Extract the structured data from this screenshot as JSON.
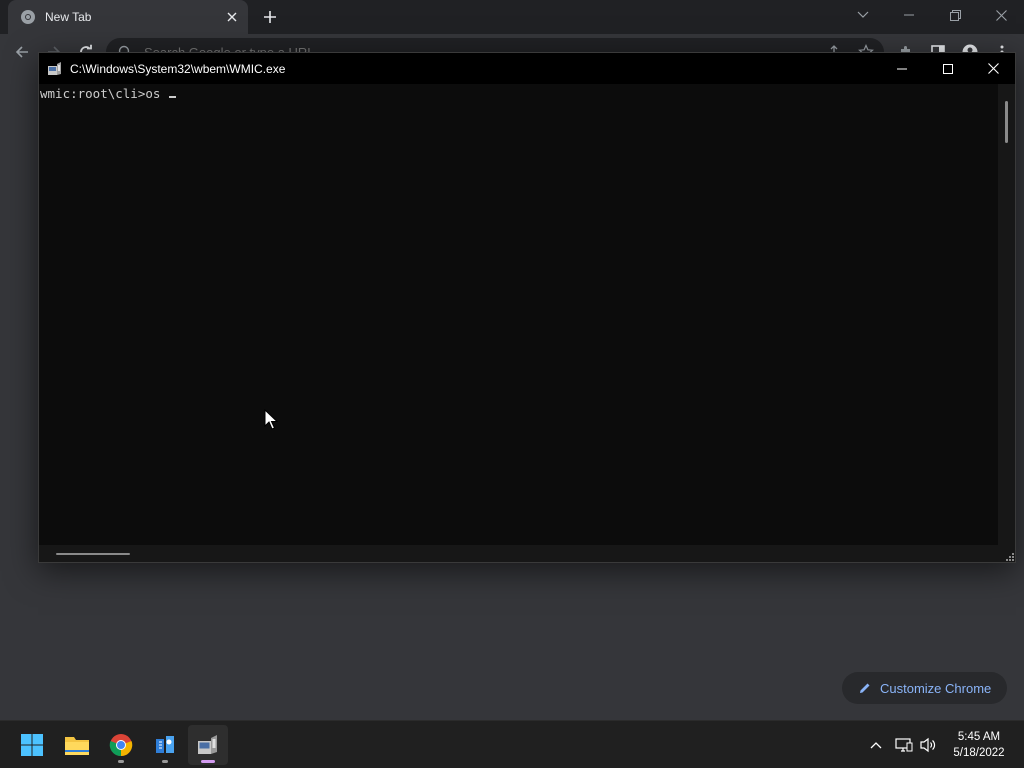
{
  "chrome": {
    "tab_title": "New Tab",
    "omnibox_placeholder": "Search Google or type a URL",
    "customize_label": "Customize Chrome"
  },
  "console": {
    "title": "C:\\Windows\\System32\\wbem\\WMIC.exe",
    "prompt": "wmic:root\\cli>os "
  },
  "taskbar": {
    "apps": [
      "start-icon",
      "file-explorer-icon",
      "chrome-icon",
      "network-admin-icon",
      "wmic-icon"
    ],
    "clock_time": "5:45 AM",
    "clock_date": "5/18/2022"
  },
  "colors": {
    "accent": "#8ab4f8",
    "console_bg": "#0c0c0c",
    "taskbar_active": "#d39cf0"
  }
}
